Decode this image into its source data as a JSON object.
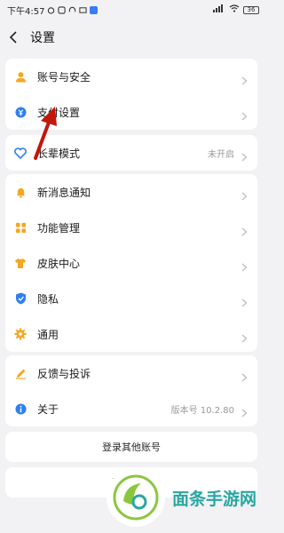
{
  "status": {
    "time": "下午4:57",
    "battery": "36"
  },
  "header": {
    "title": "设置"
  },
  "groups": {
    "account": [
      {
        "label": "账号与安全",
        "icon": "person-icon",
        "color": "#f5a623"
      },
      {
        "label": "支付设置",
        "icon": "payment-icon",
        "color": "#2f80ed"
      }
    ],
    "elder": {
      "label": "长辈模式",
      "value": "未开启",
      "icon": "heart-icon",
      "color": "#2f80ed"
    },
    "general": [
      {
        "label": "新消息通知",
        "icon": "bell-icon",
        "color": "#f5a623"
      },
      {
        "label": "功能管理",
        "icon": "grid-icon",
        "color": "#f5a623"
      },
      {
        "label": "皮肤中心",
        "icon": "shirt-icon",
        "color": "#f5a623"
      },
      {
        "label": "隐私",
        "icon": "shield-icon",
        "color": "#2f80ed"
      },
      {
        "label": "通用",
        "icon": "gear-icon",
        "color": "#f5a623"
      }
    ],
    "about": [
      {
        "label": "反馈与投诉",
        "icon": "pencil-icon",
        "color": "#f5a623"
      },
      {
        "label": "关于",
        "value": "版本号 10.2.80",
        "icon": "info-icon",
        "color": "#2f80ed"
      }
    ]
  },
  "buttons": {
    "login_other": "登录其他账号",
    "logout": "退出登录"
  },
  "watermark": {
    "text": "面条手游网"
  }
}
